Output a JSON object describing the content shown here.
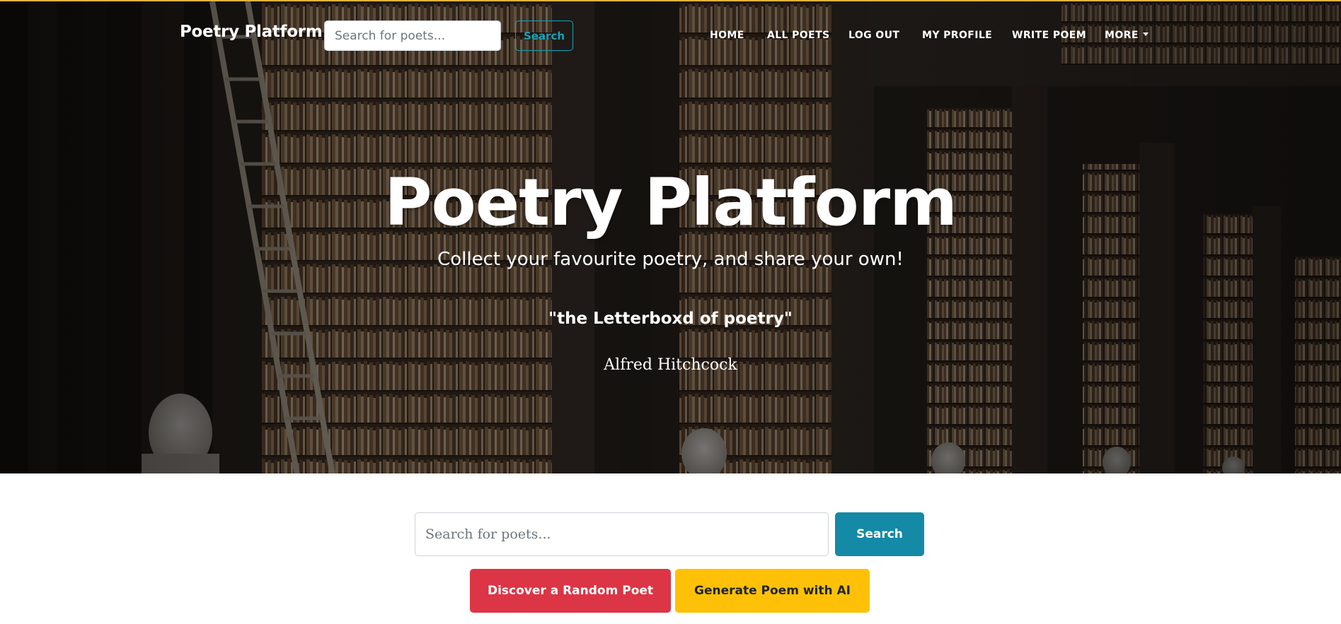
{
  "navbar": {
    "brand": "Poetry Platform",
    "search_placeholder": "Search for poets...",
    "search_button": "Search",
    "links": {
      "home": "HOME",
      "all_poets": "ALL POETS",
      "log_out": "LOG OUT",
      "my_profile": "MY PROFILE",
      "write_poem": "WRITE POEM",
      "more": "MORE"
    }
  },
  "hero": {
    "title": "Poetry Platform",
    "subtitle": "Collect your favourite poetry, and share your own!",
    "quote": "\"the Letterboxd of poetry\"",
    "author": "Alfred Hitchcock",
    "background": "library-bookshelves-image"
  },
  "main": {
    "search_placeholder": "Search for poets...",
    "search_button": "Search",
    "random_poet_button": "Discover a Random Poet",
    "generate_poem_button": "Generate Poem with AI"
  },
  "colors": {
    "accent_teal": "#148aa6",
    "nav_search_outline": "#17a2b8",
    "danger_red": "#dc3545",
    "warning_yellow": "#ffc107",
    "top_border": "#e0b43c"
  }
}
